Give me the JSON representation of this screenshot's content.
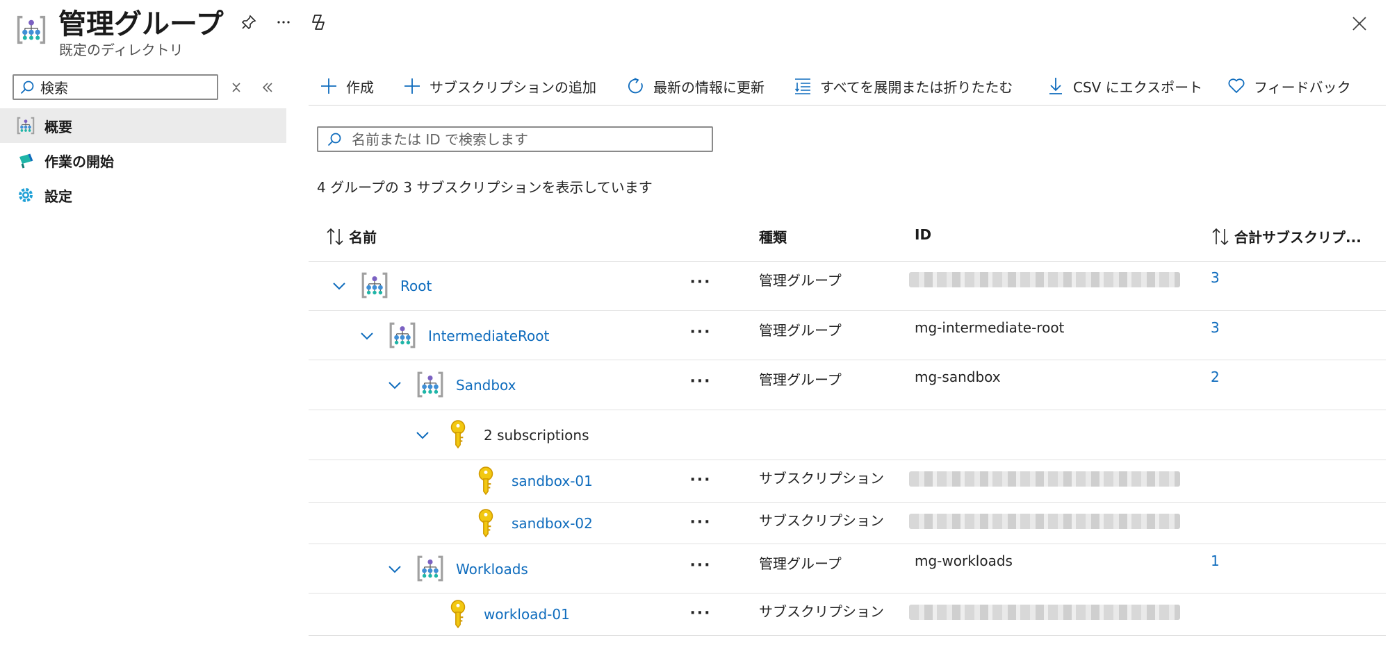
{
  "header": {
    "title": "管理グループ",
    "subtitle": "既定のディレクトリ",
    "icons": [
      "management-group-icon",
      "pin-icon",
      "more-icon",
      "copilot-icon",
      "close-icon"
    ]
  },
  "sidebar": {
    "search": {
      "value": "検索",
      "placeholder": "検索"
    },
    "items": [
      {
        "label": "概要",
        "icon": "management-group-icon",
        "active": true
      },
      {
        "label": "作業の開始",
        "icon": "quickstart-flag-icon",
        "active": false
      },
      {
        "label": "設定",
        "icon": "gear-icon",
        "active": false
      }
    ]
  },
  "toolbar": {
    "create": "作成",
    "add_subscription": "サブスクリプションの追加",
    "refresh": "最新の情報に更新",
    "expand_collapse": "すべてを展開または折りたたむ",
    "export_csv": "CSV にエクスポート",
    "feedback": "フィードバック"
  },
  "main": {
    "search_placeholder": "名前または ID で検索します",
    "summary": "4 グループの 3 サブスクリプションを表示しています",
    "columns": {
      "name": "名前",
      "type": "種類",
      "id": "ID",
      "total": "合計サブスクリプ..."
    },
    "rows": [
      {
        "name": "Root",
        "type": "管理グループ",
        "id": "",
        "total": "3"
      },
      {
        "name": "IntermediateRoot",
        "type": "管理グループ",
        "id": "mg-intermediate-root",
        "total": "3"
      },
      {
        "name": "Sandbox",
        "type": "管理グループ",
        "id": "mg-sandbox",
        "total": "2"
      },
      {
        "name": "2 subscriptions",
        "type": "",
        "id": "",
        "total": ""
      },
      {
        "name": "sandbox-01",
        "type": "サブスクリプション",
        "id": "",
        "total": ""
      },
      {
        "name": "sandbox-02",
        "type": "サブスクリプション",
        "id": "",
        "total": ""
      },
      {
        "name": "Workloads",
        "type": "管理グループ",
        "id": "mg-workloads",
        "total": "1"
      },
      {
        "name": "workload-01",
        "type": "サブスクリプション",
        "id": "",
        "total": ""
      }
    ]
  },
  "colors": {
    "link": "#0f6cbd",
    "key": "#f2c811",
    "accent": "#0f6cbd"
  }
}
